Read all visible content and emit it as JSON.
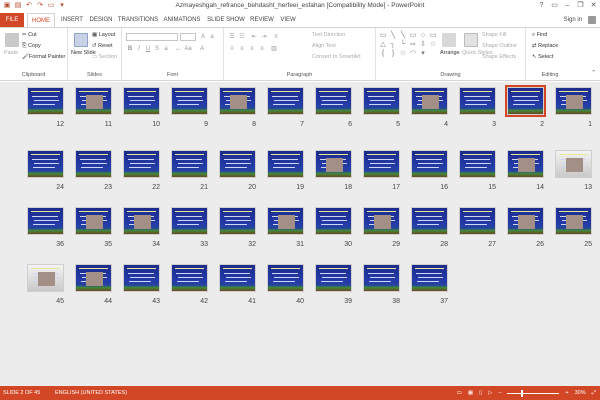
{
  "window": {
    "title": "Azmayeshgah_refrance_behdasht_herfeei_esfahan [Compatibility Mode] - PowerPoint"
  },
  "tabs": [
    "FILE",
    "HOME",
    "INSERT",
    "DESIGN",
    "TRANSITIONS",
    "ANIMATIONS",
    "SLIDE SHOW",
    "REVIEW",
    "VIEW"
  ],
  "active_tab": "HOME",
  "account": {
    "sign_in": "Sign in"
  },
  "ribbon": {
    "clipboard": {
      "paste": "Paste",
      "cut": "Cut",
      "copy": "Copy",
      "format_painter": "Format Painter",
      "label": "Clipboard"
    },
    "slides": {
      "new_slide": "New Slide",
      "layout": "Layout",
      "reset": "Reset",
      "section": "Section",
      "label": "Slides"
    },
    "font": {
      "label": "Font"
    },
    "paragraph": {
      "text_direction": "Text Direction",
      "align_text": "Align Text",
      "convert_smartart": "Convert to SmartArt",
      "label": "Paragraph"
    },
    "drawing": {
      "arrange": "Arrange",
      "quick_styles": "Quick Styles",
      "shape_fill": "Shape Fill",
      "shape_outline": "Shape Outline",
      "shape_effects": "Shape Effects",
      "label": "Drawing"
    },
    "editing": {
      "find": "Find",
      "replace": "Replace",
      "select": "Select",
      "label": "Editing"
    }
  },
  "slides": {
    "selected": 2,
    "rows": [
      [
        12,
        11,
        10,
        9,
        8,
        7,
        6,
        5,
        4,
        3,
        2,
        1
      ],
      [
        24,
        23,
        22,
        21,
        20,
        19,
        18,
        17,
        16,
        15,
        14,
        13
      ],
      [
        36,
        35,
        34,
        33,
        32,
        31,
        30,
        29,
        28,
        27,
        26,
        25
      ],
      [
        45,
        44,
        43,
        42,
        41,
        40,
        39,
        38,
        37
      ]
    ]
  },
  "statusbar": {
    "slide_info": "SLIDE 2 OF 45",
    "language": "ENGLISH (UNITED STATES)",
    "zoom": "30%"
  }
}
